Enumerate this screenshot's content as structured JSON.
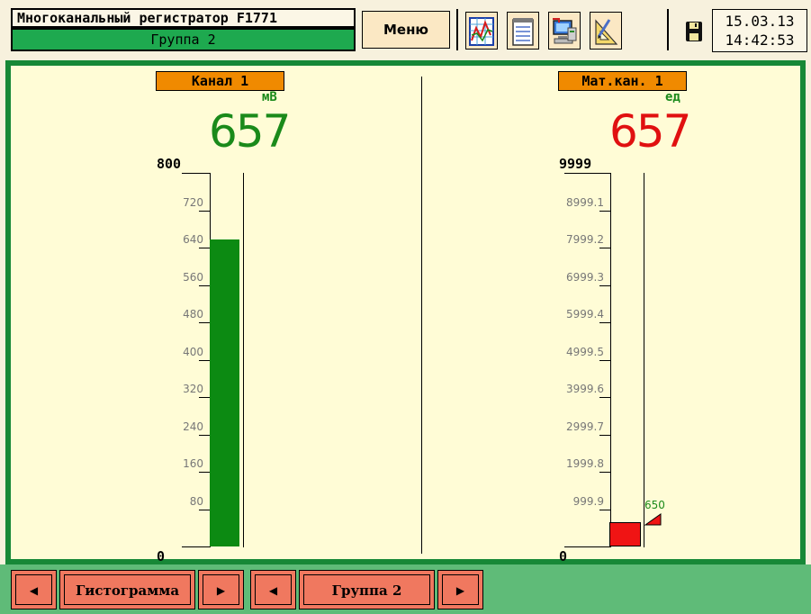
{
  "header": {
    "title": "Многоканальный регистратор F1771",
    "group": "Группа 2",
    "menu_label": "Меню",
    "tools": [
      "chart-icon",
      "notepad-icon",
      "computer-icon",
      "ruler-icon"
    ],
    "save_icon": "floppy-disk-icon",
    "date": "15.03.13",
    "time": "14:42:53"
  },
  "channels": [
    {
      "label": "Канал 1",
      "unit": "мВ",
      "value": "657",
      "value_color": "#1a8a1a",
      "bar_color": "#0c8a12",
      "scale_max": "800",
      "scale_min": "0",
      "ticks": [
        "720",
        "640",
        "560",
        "480",
        "400",
        "320",
        "240",
        "160",
        "80"
      ],
      "bar_level": 0.8213
    },
    {
      "label": "Мат.кан. 1",
      "unit": "ед",
      "value": "657",
      "value_color": "#e01010",
      "bar_color": "#f01414",
      "scale_max": "9999",
      "scale_min": "0",
      "ticks": [
        "8999.1",
        "7999.2",
        "6999.3",
        "5999.4",
        "4999.5",
        "3999.6",
        "2999.7",
        "1999.8",
        "999.9"
      ],
      "bar_level": 0.0657,
      "setpoint": "650",
      "setpoint_color": "#1a8a1a"
    }
  ],
  "footer": {
    "view_label": "Гистограмма",
    "group_label": "Группа 2",
    "prev_symbol": "◀",
    "next_symbol": "▶"
  }
}
